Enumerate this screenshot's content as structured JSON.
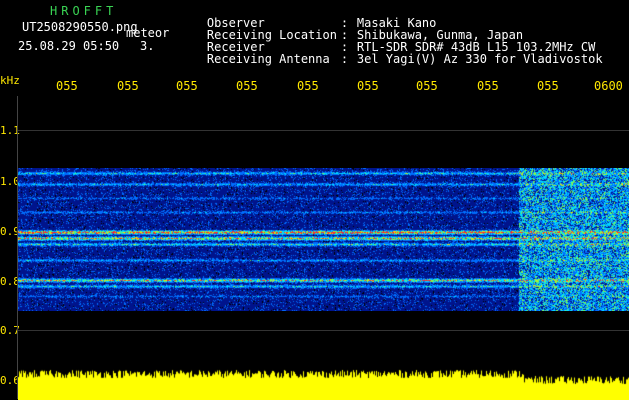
{
  "header": {
    "logo": "HROFFT",
    "filename": "UT2508290550.png",
    "type_label": "meteor",
    "datetime": "25.08.29 05:50",
    "extra": "3.",
    "fields": [
      {
        "key": "Observer",
        "value": "Masaki Kano"
      },
      {
        "key": "Receiving Location",
        "value": "Shibukawa, Gunma, Japan"
      },
      {
        "key": "Receiver",
        "value": "RTL-SDR SDR# 43dB L15 103.2MHz CW"
      },
      {
        "key": "Receiving Antenna",
        "value": "3el Yagi(V) Az 330 for Vladivostok"
      }
    ]
  },
  "axes": {
    "y_unit": "kHz",
    "y_ticks": [
      "1.1",
      "1.0",
      "0.9",
      "0.8",
      "0.7",
      "0.6"
    ],
    "x_ticks": [
      "055",
      "055",
      "055",
      "055",
      "055",
      "055",
      "055",
      "055",
      "055",
      "0600"
    ]
  },
  "colors": {
    "background": "#000000",
    "text": "#ffffff",
    "tick": "#ffe800",
    "logo": "#39d353",
    "spectrum_low": "#000a6e",
    "spectrum_mid": "#00c8ff",
    "spectrum_high": "#ff2020",
    "baseline": "#ffff00"
  }
}
